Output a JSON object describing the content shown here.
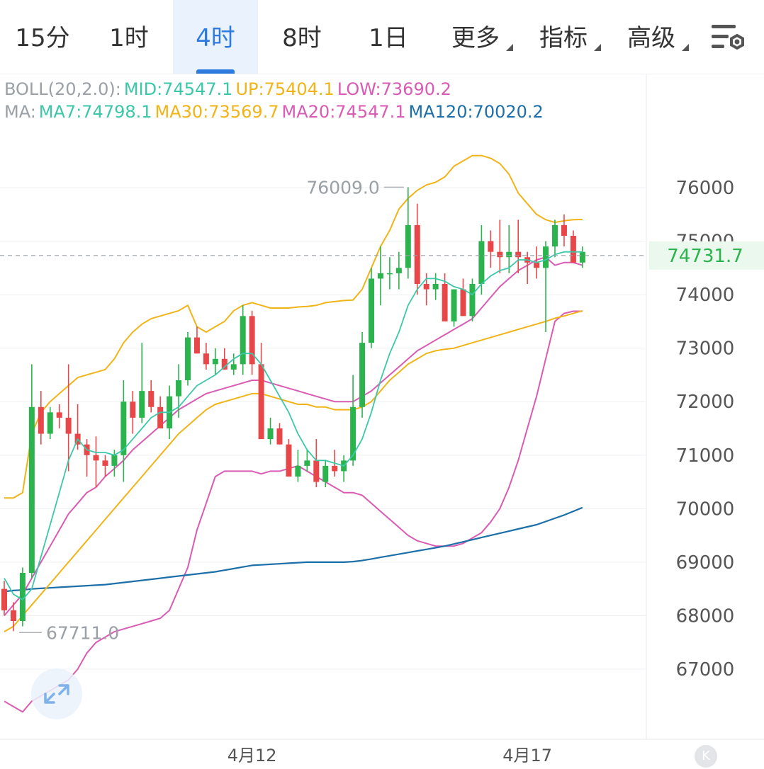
{
  "tabs": [
    {
      "label": "15分",
      "active": false
    },
    {
      "label": "1时",
      "active": false
    },
    {
      "label": "4时",
      "active": true
    },
    {
      "label": "8时",
      "active": false
    },
    {
      "label": "1日",
      "active": false
    },
    {
      "label": "更多",
      "active": false
    },
    {
      "label": "指标",
      "active": false
    },
    {
      "label": "高级",
      "active": false
    }
  ],
  "settings_icon": "chart-settings-icon",
  "boll_legend": {
    "name": "BOLL(20,2.0):",
    "mid": "MID:74547.1",
    "up": "UP:75404.1",
    "low": "LOW:73690.2"
  },
  "ma_legend": {
    "name": "MA:",
    "ma7": "MA7:74798.1",
    "ma30": "MA30:73569.7",
    "ma20": "MA20:74547.1",
    "ma120": "MA120:70020.2"
  },
  "colors": {
    "up": "#2bb44e",
    "down": "#e8474a",
    "ma7": "#3cc8a8",
    "ma30": "#f0b418",
    "ma20": "#d95bb4",
    "ma120": "#1c6fa8",
    "boll_up": "#f0b418",
    "boll_low": "#d95bb4",
    "last_price_tag_bg": "#eaf8ee",
    "last_price_tag_text": "#2bb44e",
    "grid": "#eef0f3",
    "axis_text": "#555555"
  },
  "chart_data": {
    "type": "candlestick",
    "ylim": [
      66200,
      76400
    ],
    "yticks": [
      67000,
      68000,
      69000,
      70000,
      71000,
      72000,
      73000,
      74000,
      75000,
      76000
    ],
    "ytick_labels": [
      "67000",
      "68000",
      "69000",
      "70000",
      "71000",
      "72000",
      "73000",
      "74000",
      "75000",
      "76000"
    ],
    "xtick_labels": [
      {
        "index": 27,
        "label": "4月12"
      },
      {
        "index": 57,
        "label": "4月17"
      }
    ],
    "last_price": 74731.7,
    "last_price_label": "74731.7",
    "high_marker": {
      "index": 44,
      "value": 76009.0,
      "label": "76009.0"
    },
    "low_marker": {
      "index": 1,
      "value": 67711.0,
      "label": "67711.0"
    },
    "candles": [
      [
        68500,
        68650,
        68000,
        68100
      ],
      [
        68100,
        68250,
        67711,
        67900
      ],
      [
        67900,
        68900,
        67800,
        68800
      ],
      [
        68800,
        72700,
        68700,
        71900
      ],
      [
        71900,
        72200,
        71200,
        71400
      ],
      [
        71400,
        71900,
        71300,
        71800
      ],
      [
        71800,
        71950,
        71500,
        71700
      ],
      [
        71700,
        72700,
        70700,
        71400
      ],
      [
        71400,
        71950,
        71100,
        71200
      ],
      [
        71200,
        71300,
        70600,
        71000
      ],
      [
        71000,
        71350,
        70400,
        70900
      ],
      [
        70900,
        71000,
        70600,
        70800
      ],
      [
        70800,
        71100,
        70600,
        71000
      ],
      [
        71000,
        72400,
        70500,
        72000
      ],
      [
        72000,
        72200,
        71400,
        71700
      ],
      [
        71700,
        73100,
        71600,
        72200
      ],
      [
        72200,
        72400,
        71800,
        71900
      ],
      [
        71900,
        72100,
        71500,
        71500
      ],
      [
        71500,
        72300,
        71300,
        72100
      ],
      [
        72100,
        72700,
        71700,
        72400
      ],
      [
        72400,
        73300,
        72300,
        73200
      ],
      [
        73200,
        73400,
        72900,
        72900
      ],
      [
        72900,
        73100,
        72600,
        72700
      ],
      [
        72700,
        73000,
        72500,
        72800
      ],
      [
        72800,
        73000,
        72600,
        72600
      ],
      [
        72600,
        72900,
        72500,
        72700
      ],
      [
        72700,
        73800,
        72500,
        73600
      ],
      [
        73600,
        73700,
        72500,
        72700
      ],
      [
        72700,
        73100,
        71500,
        71300
      ],
      [
        71300,
        71700,
        71200,
        71500
      ],
      [
        71500,
        71600,
        71200,
        71200
      ],
      [
        71200,
        71300,
        70600,
        70600
      ],
      [
        70600,
        71100,
        70500,
        70800
      ],
      [
        70800,
        71100,
        70700,
        70900
      ],
      [
        70900,
        71300,
        70400,
        70500
      ],
      [
        70500,
        70900,
        70400,
        70800
      ],
      [
        70800,
        71100,
        70600,
        70700
      ],
      [
        70700,
        71000,
        70500,
        70900
      ],
      [
        70900,
        72500,
        70800,
        71900
      ],
      [
        71900,
        73300,
        71700,
        73100
      ],
      [
        73100,
        74500,
        73000,
        74300
      ],
      [
        74300,
        74900,
        73800,
        74400
      ],
      [
        74400,
        74700,
        74100,
        74400
      ],
      [
        74400,
        74800,
        74100,
        74500
      ],
      [
        74500,
        76009,
        74300,
        75300
      ],
      [
        75300,
        75700,
        74000,
        74200
      ],
      [
        74200,
        74400,
        73800,
        74100
      ],
      [
        74100,
        74400,
        73900,
        74200
      ],
      [
        74200,
        74400,
        73600,
        73500
      ],
      [
        73500,
        74100,
        73400,
        74100
      ],
      [
        74100,
        74300,
        73600,
        73600
      ],
      [
        73600,
        74300,
        73500,
        74200
      ],
      [
        74200,
        75300,
        74000,
        75000
      ],
      [
        75000,
        75200,
        74500,
        74800
      ],
      [
        74800,
        75400,
        74400,
        74700
      ],
      [
        74700,
        75300,
        74400,
        74800
      ],
      [
        74800,
        75400,
        74400,
        74700
      ],
      [
        74700,
        74800,
        74200,
        74600
      ],
      [
        74600,
        74900,
        74300,
        74500
      ],
      [
        74500,
        75000,
        73300,
        74900
      ],
      [
        74900,
        75400,
        74700,
        75300
      ],
      [
        75300,
        75500,
        74900,
        75100
      ],
      [
        75100,
        75200,
        74700,
        74600
      ],
      [
        74600,
        74900,
        74500,
        74800
      ]
    ],
    "ma7": [
      68700,
      68400,
      68300,
      68500,
      69100,
      69700,
      70300,
      70900,
      71300,
      71100,
      71050,
      71050,
      71000,
      71100,
      71300,
      71500,
      71700,
      71800,
      71800,
      71900,
      72100,
      72300,
      72400,
      72500,
      72650,
      72800,
      72900,
      72900,
      72700,
      72400,
      72100,
      71800,
      71400,
      71100,
      70900,
      70900,
      70850,
      70800,
      71000,
      71300,
      71800,
      72400,
      72900,
      73300,
      73800,
      74100,
      74300,
      74300,
      74250,
      74150,
      74100,
      74000,
      74200,
      74350,
      74450,
      74500,
      74650,
      74650,
      74600,
      74650,
      74750,
      74800,
      74800,
      74800
    ],
    "ma30": [
      67700,
      67800,
      68000,
      68200,
      68400,
      68600,
      68800,
      69000,
      69200,
      69400,
      69600,
      69800,
      70000,
      70200,
      70400,
      70600,
      70800,
      71000,
      71200,
      71400,
      71550,
      71700,
      71850,
      71950,
      72000,
      72050,
      72100,
      72150,
      72150,
      72100,
      72050,
      72000,
      71950,
      71950,
      71900,
      71900,
      71850,
      71850,
      71850,
      71900,
      72000,
      72200,
      72400,
      72550,
      72700,
      72800,
      72900,
      72950,
      72980,
      73000,
      73050,
      73100,
      73150,
      73200,
      73250,
      73300,
      73350,
      73400,
      73450,
      73500,
      73560,
      73600,
      73650,
      73700
    ],
    "ma20": [
      68000,
      68200,
      68400,
      68700,
      69000,
      69300,
      69600,
      69900,
      70100,
      70300,
      70400,
      70600,
      70750,
      70900,
      71100,
      71250,
      71400,
      71550,
      71700,
      71850,
      71950,
      72050,
      72150,
      72200,
      72250,
      72300,
      72350,
      72400,
      72400,
      72350,
      72300,
      72250,
      72200,
      72150,
      72100,
      72050,
      72000,
      72000,
      72000,
      72100,
      72200,
      72350,
      72500,
      72650,
      72800,
      72950,
      73050,
      73150,
      73250,
      73350,
      73450,
      73550,
      73750,
      73950,
      74150,
      74300,
      74450,
      74550,
      74650,
      74700,
      74550,
      74600,
      74600,
      74550
    ],
    "ma120": [
      68450,
      68470,
      68480,
      68500,
      68510,
      68520,
      68530,
      68540,
      68550,
      68560,
      68570,
      68580,
      68600,
      68620,
      68640,
      68660,
      68680,
      68700,
      68720,
      68740,
      68760,
      68780,
      68800,
      68820,
      68850,
      68880,
      68910,
      68940,
      68950,
      68960,
      68970,
      68980,
      68990,
      69000,
      69000,
      69000,
      69000,
      69000,
      69010,
      69030,
      69060,
      69090,
      69120,
      69150,
      69180,
      69210,
      69240,
      69270,
      69300,
      69340,
      69380,
      69420,
      69460,
      69500,
      69540,
      69580,
      69620,
      69660,
      69700,
      69760,
      69820,
      69880,
      69950,
      70020
    ],
    "boll_up": [
      70200,
      70200,
      70300,
      71400,
      71800,
      72000,
      72150,
      72300,
      72450,
      72500,
      72550,
      72600,
      72800,
      73100,
      73300,
      73450,
      73550,
      73600,
      73650,
      73700,
      73800,
      73400,
      73300,
      73400,
      73500,
      73700,
      73800,
      73850,
      73800,
      73750,
      73750,
      73750,
      73770,
      73780,
      73800,
      73850,
      73870,
      73890,
      73900,
      74100,
      74500,
      74900,
      75200,
      75600,
      75800,
      75950,
      76050,
      76100,
      76200,
      76400,
      76500,
      76600,
      76600,
      76550,
      76450,
      76250,
      75900,
      75700,
      75500,
      75400,
      75350,
      75380,
      75400,
      75404
    ],
    "boll_low": [
      66400,
      66300,
      66200,
      66400,
      66500,
      66600,
      66700,
      66800,
      67000,
      67300,
      67500,
      67600,
      67700,
      67750,
      67800,
      67850,
      67900,
      67950,
      68100,
      68500,
      68900,
      69600,
      70100,
      70600,
      70700,
      70700,
      70700,
      70700,
      70650,
      70700,
      70700,
      70750,
      70800,
      70700,
      70600,
      70500,
      70400,
      70300,
      70300,
      70250,
      70100,
      69950,
      69800,
      69650,
      69500,
      69400,
      69350,
      69300,
      69300,
      69300,
      69350,
      69450,
      69550,
      69750,
      70000,
      70400,
      70900,
      71500,
      72100,
      72800,
      73500,
      73650,
      73690,
      73690
    ]
  }
}
